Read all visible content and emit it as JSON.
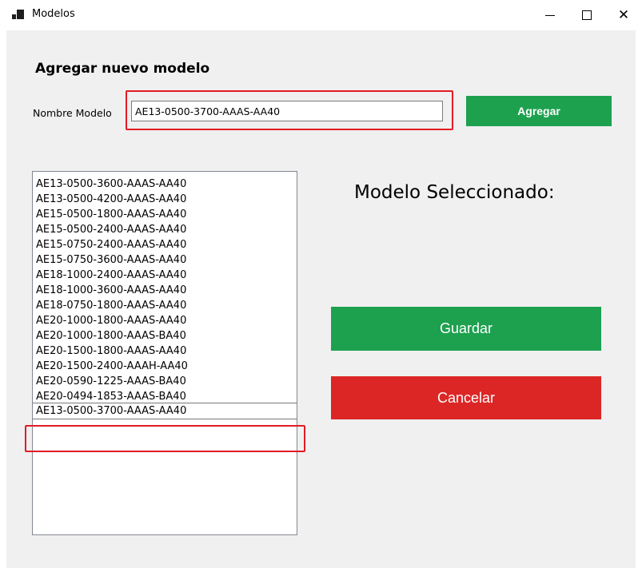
{
  "window": {
    "title": "Modelos",
    "minimize_icon": "minimize-icon",
    "maximize_icon": "maximize-icon",
    "close_icon": "close-icon"
  },
  "add_section": {
    "heading": "Agregar nuevo modelo",
    "name_label": "Nombre Modelo",
    "name_value": "AE13-0500-3700-AAAS-AA40",
    "add_button": "Agregar"
  },
  "models": [
    "AE13-0500-3600-AAAS-AA40",
    "AE13-0500-4200-AAAS-AA40",
    "AE15-0500-1800-AAAS-AA40",
    "AE15-0500-2400-AAAS-AA40",
    "AE15-0750-2400-AAAS-AA40",
    "AE15-0750-3600-AAAS-AA40",
    "AE18-1000-2400-AAAS-AA40",
    "AE18-1000-3600-AAAS-AA40",
    "AE18-0750-1800-AAAS-AA40",
    "AE20-1000-1800-AAAS-AA40",
    "AE20-1000-1800-AAAS-BA40",
    "AE20-1500-1800-AAAS-AA40",
    "AE20-1500-2400-AAAH-AA40",
    "AE20-0590-1225-AAAS-BA40",
    "AE20-0494-1853-AAAS-BA40",
    "AE13-0500-3700-AAAS-AA40"
  ],
  "selected_index": 15,
  "selected_section": {
    "title": "Modelo Seleccionado:"
  },
  "actions": {
    "save": "Guardar",
    "cancel": "Cancelar"
  },
  "colors": {
    "primary": "#1da14f",
    "danger": "#dc2626",
    "highlight": "#e21b25"
  }
}
